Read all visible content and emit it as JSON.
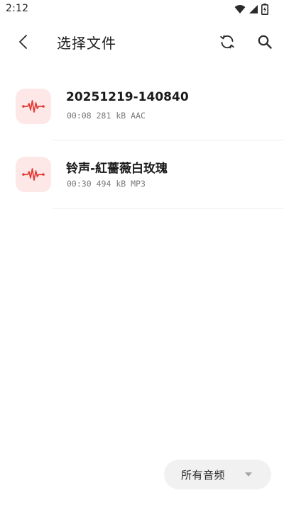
{
  "status_bar": {
    "time": "2:12",
    "icons": [
      "wifi-icon",
      "cell-signal-icon",
      "battery-icon"
    ]
  },
  "app_bar": {
    "title": "选择文件",
    "back_icon": "back-arrow-icon",
    "refresh_icon": "refresh-icon",
    "search_icon": "search-icon"
  },
  "files": [
    {
      "name": "20251219-140840",
      "duration": "00:08",
      "size": "281 kB",
      "format": "AAC",
      "icon": "audio-waveform-icon"
    },
    {
      "name": "铃声-紅薔薇白玫瑰",
      "duration": "00:30",
      "size": "494 kB",
      "format": "MP3",
      "icon": "audio-waveform-icon"
    }
  ],
  "filter": {
    "selected": "所有音频",
    "icon": "dropdown-caret-icon"
  },
  "colors": {
    "accent": "#e53935",
    "icon_bg": "#fde7e7",
    "filter_bg": "#f1f1f1",
    "meta_text": "#7a7a7a"
  }
}
